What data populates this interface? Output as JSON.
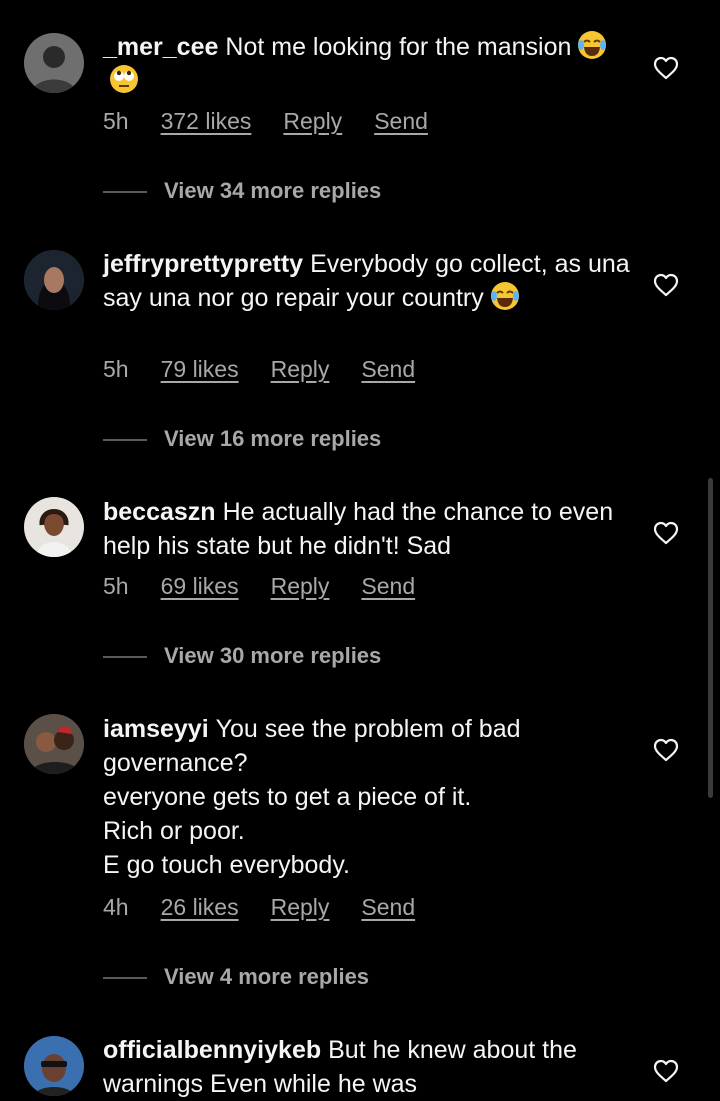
{
  "comments": [
    {
      "username": "_mer_cee",
      "text": "Not me looking for the mansion",
      "emojis": [
        "joy",
        "eye-roll"
      ],
      "time": "5h",
      "likes": "372 likes",
      "reply": "Reply",
      "send": "Send",
      "view_replies": "View 34 more replies"
    },
    {
      "username": "jeffryprettypretty",
      "text": "Everybody go collect, as una say una nor go repair your country",
      "emojis": [
        "joy"
      ],
      "time": "5h",
      "likes": "79 likes",
      "reply": "Reply",
      "send": "Send",
      "view_replies": "View 16 more replies"
    },
    {
      "username": "beccaszn",
      "text": "He actually had the chance to even help his state but he didn't! Sad",
      "time": "5h",
      "likes": "69 likes",
      "reply": "Reply",
      "send": "Send",
      "view_replies": "View 30 more replies"
    },
    {
      "username": "iamseyyi",
      "text_lines": [
        "You see the problem of bad governance?",
        "everyone gets to get a piece of it.",
        "Rich or poor.",
        "E go touch everybody."
      ],
      "time": "4h",
      "likes": "26 likes",
      "reply": "Reply",
      "send": "Send",
      "view_replies": "View 4 more replies"
    },
    {
      "username": "officialbennyiykeb",
      "text": "But he knew about the warnings Even while he was"
    }
  ],
  "icons": {
    "like": "heart-outline-icon"
  },
  "colors": {
    "background": "#000000",
    "text": "#f5f5f5",
    "secondary": "#a8a8a8"
  }
}
